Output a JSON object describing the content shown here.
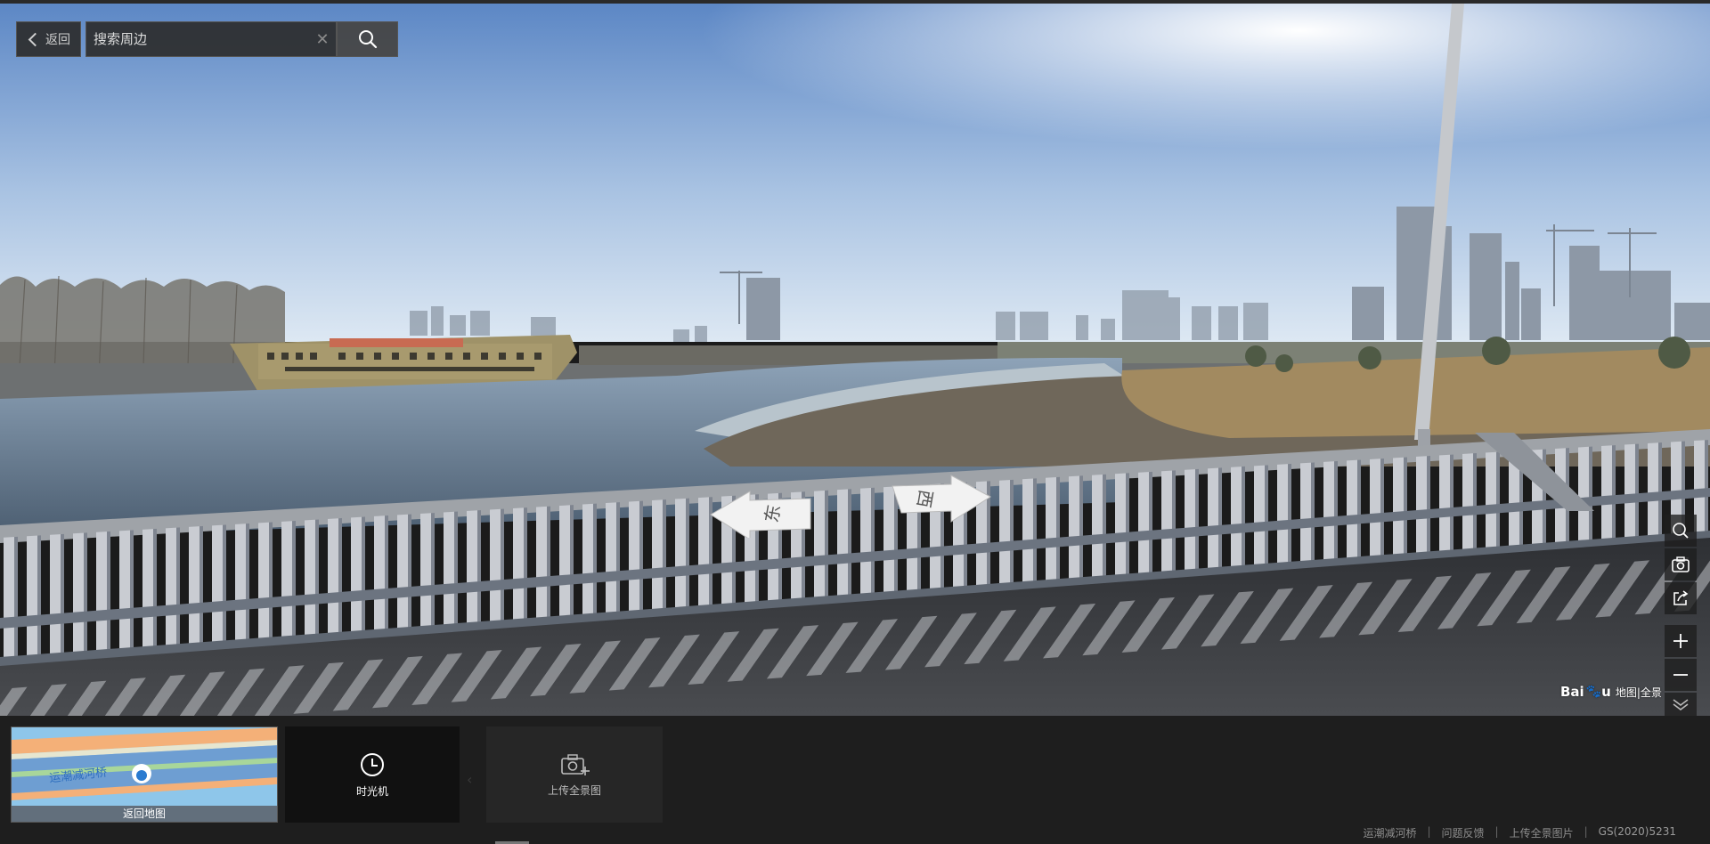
{
  "topbar": {
    "back_label": "返回",
    "search_placeholder": "搜索周边",
    "search_value": "",
    "clear_icon": "close-icon",
    "search_icon": "search-icon"
  },
  "panorama": {
    "nav_arrows": [
      {
        "label": "东",
        "direction": "left"
      },
      {
        "label": "西",
        "direction": "right"
      }
    ]
  },
  "right_toolbar": {
    "items": [
      {
        "icon": "search-icon"
      },
      {
        "icon": "camera-icon"
      },
      {
        "icon": "share-icon"
      },
      {
        "icon": "zoom-in-icon"
      },
      {
        "icon": "zoom-out-icon"
      },
      {
        "icon": "collapse-down-icon"
      }
    ]
  },
  "logo": {
    "brand": "Bai",
    "brand2": "u",
    "sub": "地图|全景"
  },
  "bottom": {
    "minimap_road_label": "运潮减河桥",
    "minimap_label": "返回地图",
    "time_machine_label": "时光机",
    "upload_label": "上传全景图"
  },
  "footer": {
    "location": "运潮减河桥",
    "feedback": "问题反馈",
    "upload": "上传全景图片",
    "license": "GS(2020)5231"
  },
  "colors": {
    "sky_top": "#5b86c4",
    "sky_bottom": "#d4e1ef",
    "water": "#5d7186",
    "road": "#3a3c40",
    "panel_bg": "#1e1e1e"
  }
}
